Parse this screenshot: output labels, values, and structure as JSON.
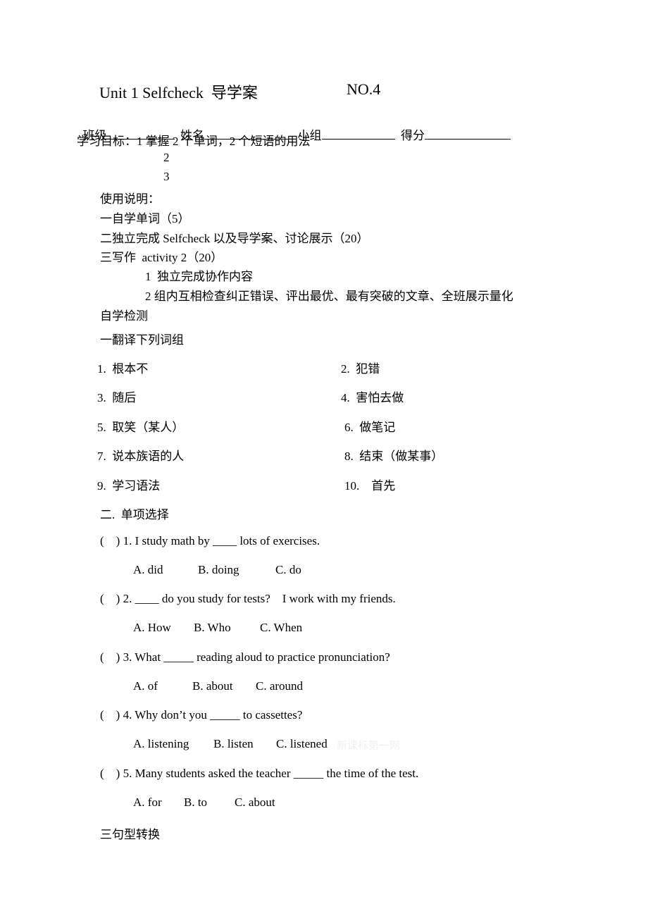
{
  "header": {
    "title": "Unit 1 Selfcheck  导学案",
    "number": "NO.4"
  },
  "info_fields": [
    {
      "label": "班级"
    },
    {
      "label": "姓名"
    },
    {
      "label": "小组"
    },
    {
      "label": "得分"
    }
  ],
  "objectives": {
    "label": "学习目标：",
    "items": [
      "1 掌握 2 个单词，2 个短语的用法",
      "2",
      "3"
    ]
  },
  "instructions": {
    "heading": "使用说明：",
    "steps": [
      "一自学单词（5）",
      "二独立完成 Selfcheck 以及导学案、讨论展示（20）",
      "三写作  activity 2（20）"
    ],
    "substeps": [
      "1  独立完成协作内容",
      "2 组内互相检查纠正错误、评出最优、最有突破的文章、全班展示量化"
    ]
  },
  "self_test": {
    "heading": "自学检测",
    "section1": {
      "heading": "一翻译下列词组",
      "items": [
        "1.  根本不",
        "2.  犯错",
        "3.  随后",
        "4.  害怕去做",
        "5.  取笑（某人）",
        "6.  做笔记",
        "7.  说本族语的人",
        "8.  结束（做某事）",
        "9.  学习语法",
        "10.    首先"
      ]
    },
    "section2": {
      "heading": "二.  单项选择",
      "questions": [
        {
          "stem": "(    ) 1. I study math by ____ lots of exercises.",
          "options": [
            "A. did",
            "B. doing",
            "C. do"
          ]
        },
        {
          "stem": "(    ) 2. ____ do you study for tests?    I work with my friends.",
          "options": [
            "A. How",
            "B. Who",
            "C. When"
          ]
        },
        {
          "stem": "(    ) 3. What _____ reading aloud to practice pronunciation?",
          "options": [
            "A. of",
            "B. about",
            "C. around"
          ]
        },
        {
          "stem": "(    ) 4. Why don’t you _____ to cassettes?",
          "options": [
            "A. listening",
            "B. listen",
            "C. listened"
          ]
        },
        {
          "stem": "(    ) 5. Many students asked the teacher _____ the time of the test.",
          "options": [
            "A. for",
            "B. to",
            "C. about"
          ]
        }
      ]
    },
    "section3": {
      "heading": "三句型转换"
    }
  },
  "watermark": "新课标第一网"
}
